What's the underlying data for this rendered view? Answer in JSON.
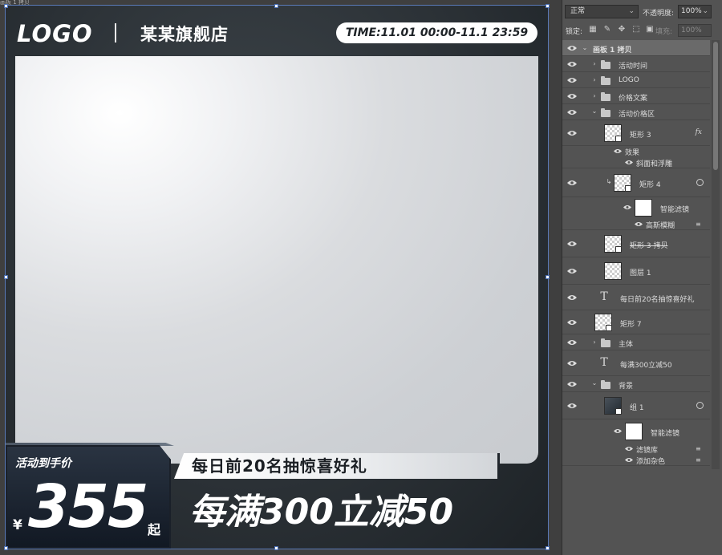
{
  "document": {
    "tab_title": "画板 1 拷贝"
  },
  "artboard": {
    "logo": "LOGO",
    "store_name": "某某旗舰店",
    "time_text": "TIME:11.01 00:00-11.1 23:59",
    "badge_label": "活动到手价",
    "currency_symbol": "¥",
    "price": "355",
    "price_suffix": "起",
    "gift_text": "每日前20名抽惊喜好礼",
    "promo_text": "每满300立减50",
    "colors": {
      "background": "#2c3237",
      "panel": "#d4d6d9",
      "text": "#ffffff",
      "badge": "#1b2330"
    }
  },
  "layers_panel": {
    "blend_mode": "正常",
    "opacity_label": "不透明度:",
    "opacity_value": "100%",
    "lock_label": "锁定:",
    "fill_label": "填充:",
    "fill_value": "100%",
    "layers": [
      {
        "name": "画板 1 拷贝",
        "kind": "artboard"
      },
      {
        "name": "活动时间",
        "kind": "group"
      },
      {
        "name": "LOGO",
        "kind": "group"
      },
      {
        "name": "价格文案",
        "kind": "group"
      },
      {
        "name": "活动价格区",
        "kind": "group"
      },
      {
        "name": "矩形 3",
        "kind": "smart"
      },
      {
        "name": "效果",
        "kind": "effect"
      },
      {
        "name": "斜面和浮雕",
        "kind": "effect-item"
      },
      {
        "name": "矩形 4",
        "kind": "smart"
      },
      {
        "name": "智能滤镜",
        "kind": "filter"
      },
      {
        "name": "高斯模糊",
        "kind": "filter-item"
      },
      {
        "name": "矩形 3 拷贝",
        "kind": "smart"
      },
      {
        "name": "图层 1",
        "kind": "layer"
      },
      {
        "name": "每日前20名抽惊喜好礼",
        "kind": "text"
      },
      {
        "name": "矩形 7",
        "kind": "smart"
      },
      {
        "name": "主体",
        "kind": "group"
      },
      {
        "name": "每满300立减50",
        "kind": "text"
      },
      {
        "name": "背景",
        "kind": "group"
      },
      {
        "name": "组 1",
        "kind": "smart"
      },
      {
        "name": "智能滤镜",
        "kind": "filter"
      },
      {
        "name": "滤镜库",
        "kind": "filter-item"
      },
      {
        "name": "添加杂色",
        "kind": "filter-item"
      }
    ]
  }
}
